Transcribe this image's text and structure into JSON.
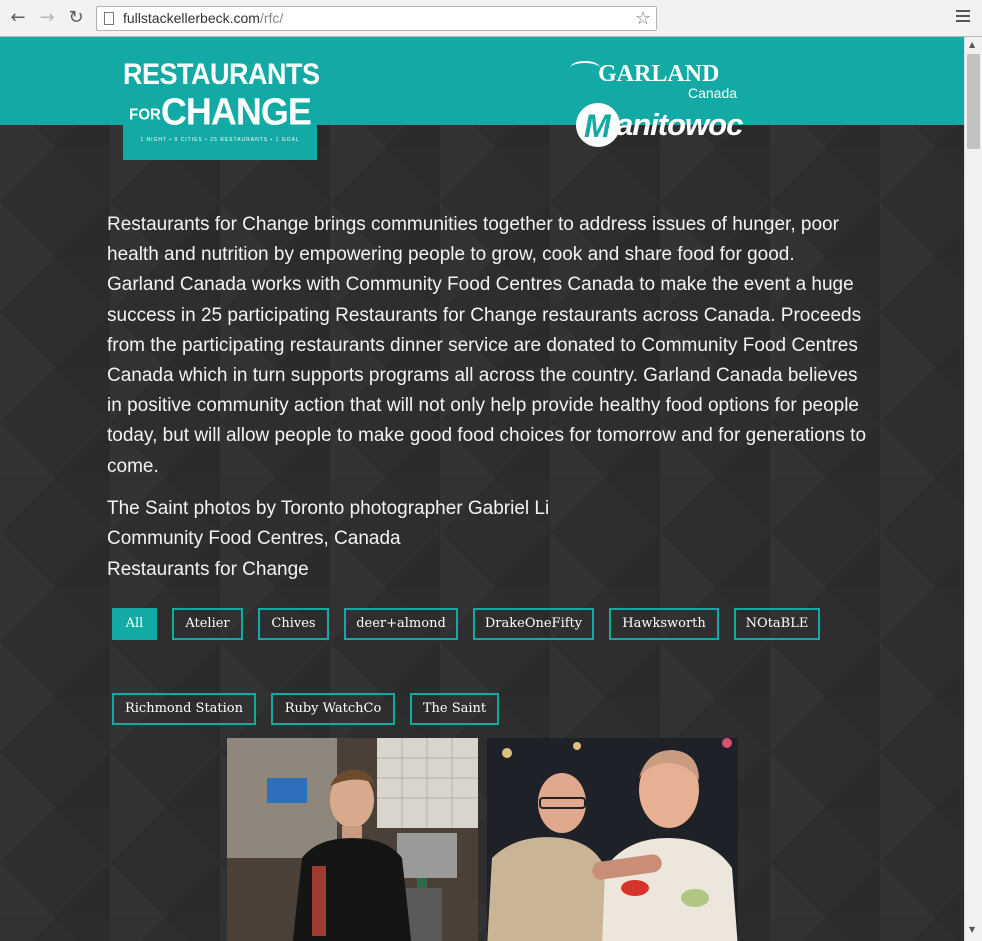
{
  "browser": {
    "url_domain": "fullstackellerbeck.com",
    "url_path": "/rfc/",
    "back_icon": "back-arrow-icon",
    "forward_icon": "forward-arrow-icon",
    "reload_icon": "reload-icon",
    "star_icon": "star-icon",
    "menu_icon": "hamburger-menu-icon"
  },
  "header": {
    "rfc_logo": {
      "line1": "RESTAURANTS",
      "line2_small": "FOR",
      "line2": "CHANGE",
      "tagline": "1 NIGHT • 9 CITIES • 25 RESTAURANTS • 1 GOAL"
    },
    "garland_logo": {
      "name": "GARLAND",
      "sub": "Canada"
    },
    "manitowoc_logo": {
      "name": "anitowoc",
      "initial": "M"
    },
    "accent_color": "#13aaa5"
  },
  "description": "Restaurants for Change brings communities together to address issues of hunger, poor health and nutrition by empowering people to grow, cook and share food for good. Garland Canada works with Community Food Centres Canada to make the event a huge success in 25 participating Restaurants for Change restaurants across Canada. Proceeds from the participating restaurants dinner service are donated to Community Food Centres Canada which in turn supports programs all across the country. Garland Canada believes in positive community action that will not only help provide healthy food options for people today, but will allow people to make good food choices for tomorrow and for generations to come.",
  "credits": [
    "The Saint photos by Toronto photographer Gabriel Li",
    "Community Food Centres, Canada",
    "Restaurants for Change"
  ],
  "filters": [
    {
      "label": "All",
      "active": true
    },
    {
      "label": "Atelier",
      "active": false
    },
    {
      "label": "Chives",
      "active": false
    },
    {
      "label": "deer+almond",
      "active": false
    },
    {
      "label": "DrakeOneFifty",
      "active": false
    },
    {
      "label": "Hawksworth",
      "active": false
    },
    {
      "label": "NOtaBLE",
      "active": false
    },
    {
      "label": "Richmond Station",
      "active": false
    },
    {
      "label": "Ruby WatchCo",
      "active": false
    },
    {
      "label": "The Saint",
      "active": false
    }
  ]
}
